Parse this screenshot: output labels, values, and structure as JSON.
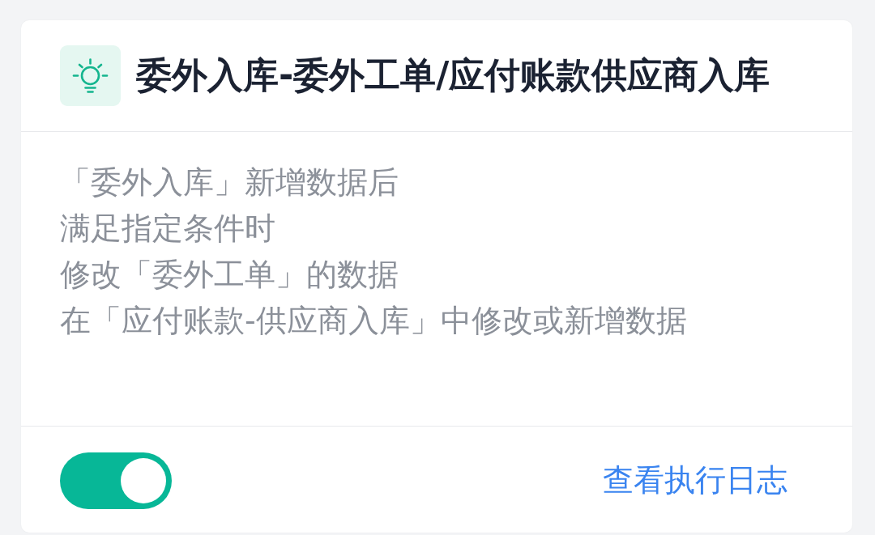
{
  "card": {
    "title": "委外入库-委外工单/应付账款供应商入库",
    "description": [
      "「委外入库」新增数据后",
      "满足指定条件时",
      "修改「委外工单」的数据",
      "在「应付账款-供应商入库」中修改或新增数据"
    ],
    "toggle": {
      "on": true
    },
    "link": "查看执行日志"
  }
}
